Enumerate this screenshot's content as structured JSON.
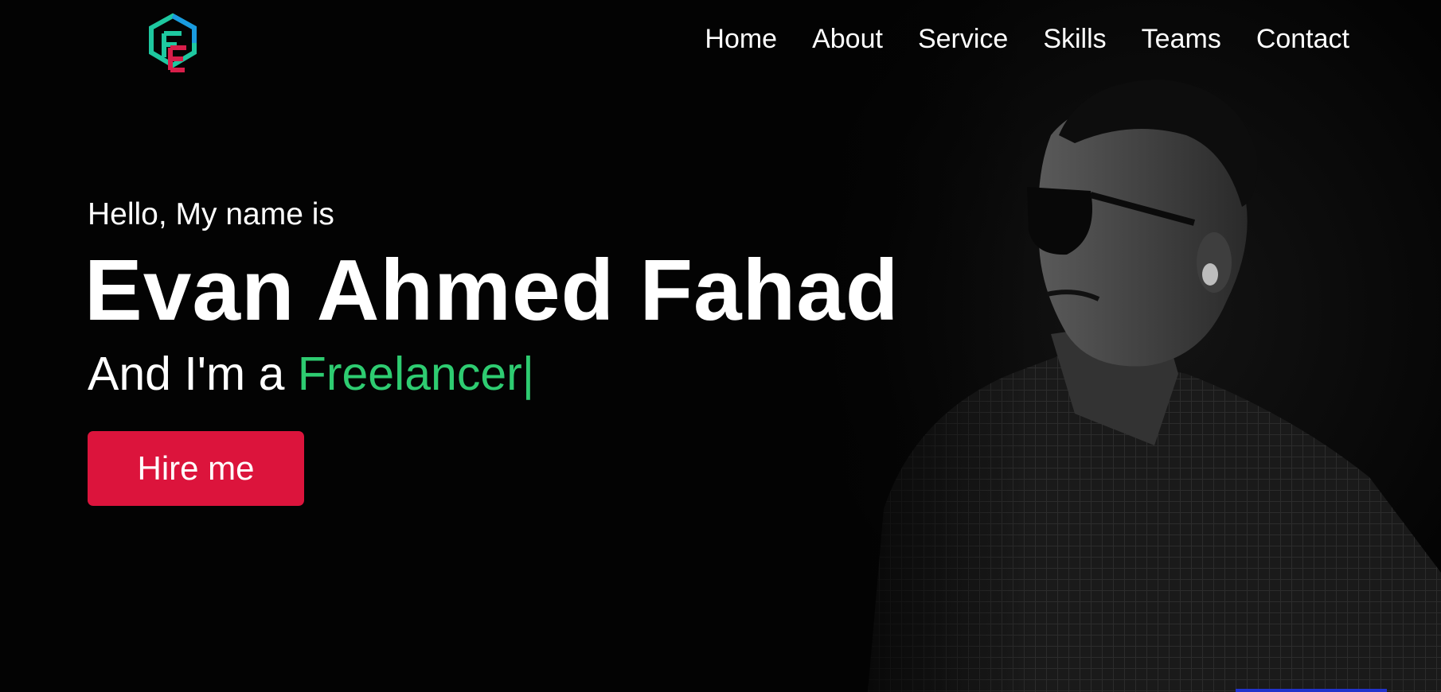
{
  "header": {
    "logo_icon": "hexagon-fe-monogram-logo",
    "nav": [
      "Home",
      "About",
      "Service",
      "Skills",
      "Teams",
      "Contact"
    ]
  },
  "hero": {
    "greeting": "Hello, My name is",
    "name": "Evan Ahmed Fahad",
    "role_prefix": "And I'm a ",
    "role_typed": "Freelancer",
    "caret": "|",
    "cta_label": "Hire me",
    "photo": "grayscale-portrait-man-sunglasses"
  },
  "colors": {
    "background": "#030303",
    "text": "#ffffff",
    "accent_green": "#2ecc71",
    "cta_red": "#dc143c",
    "logo_teal": "#1ec8a0",
    "logo_blue": "#1a9be0",
    "logo_red": "#d81e4a"
  }
}
